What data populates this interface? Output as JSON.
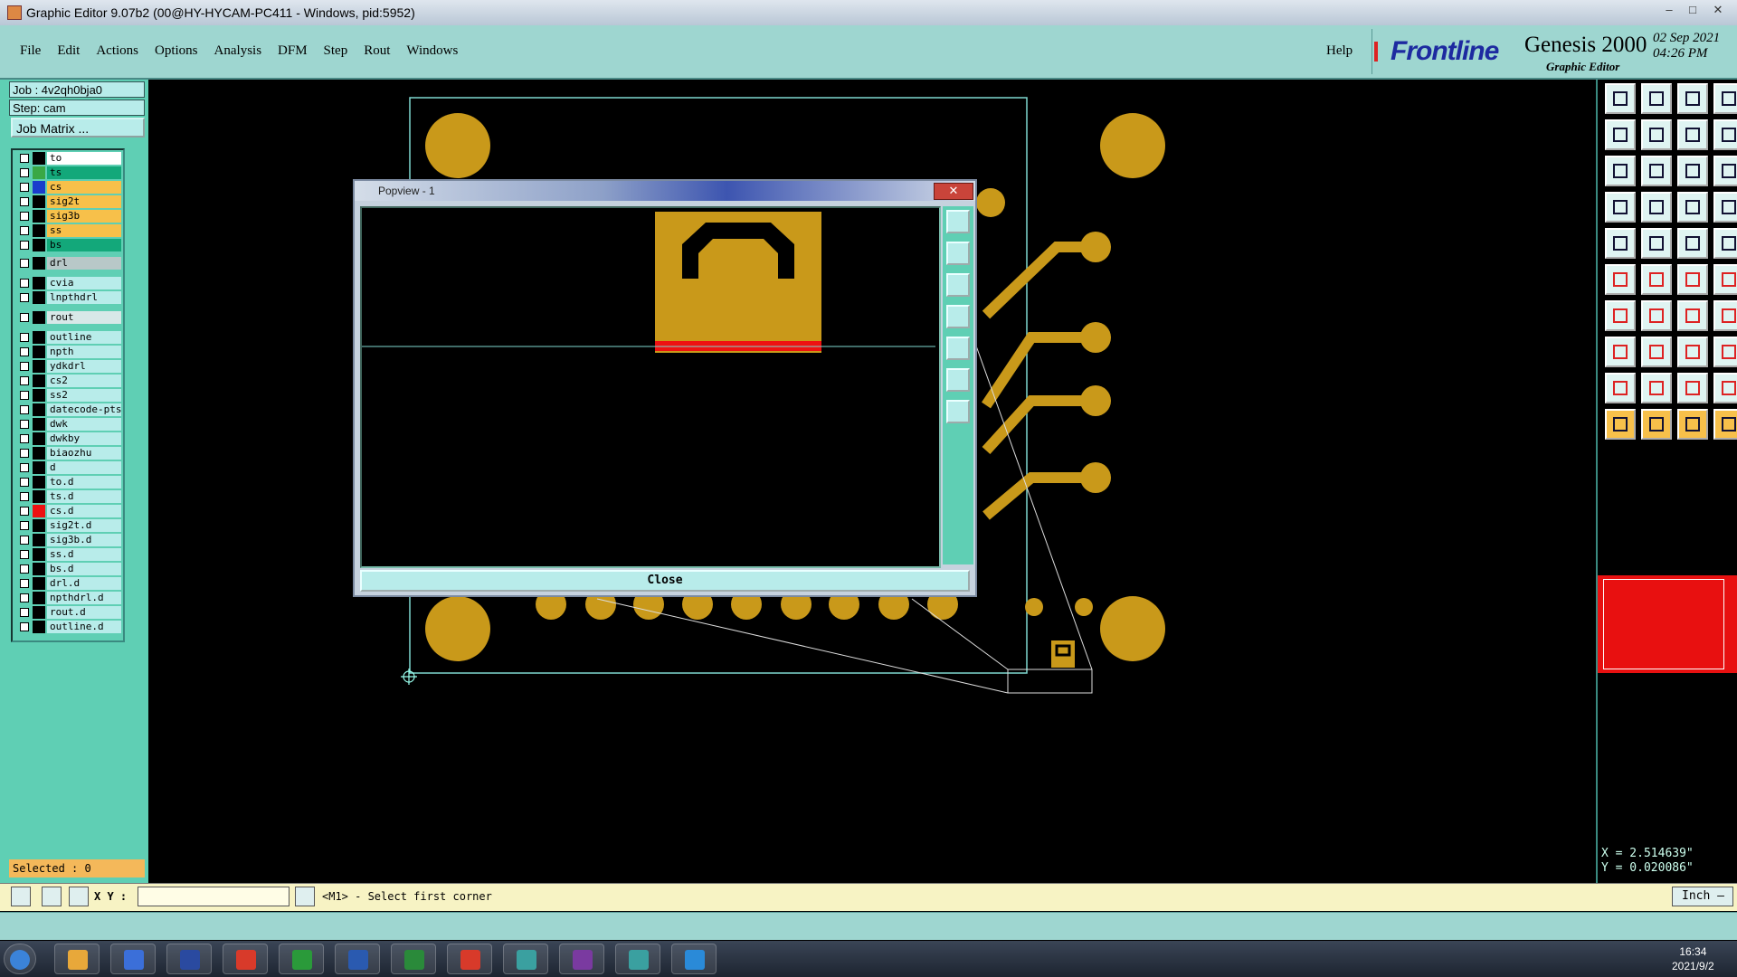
{
  "window": {
    "title": "Graphic Editor 9.07b2 (00@HY-HYCAM-PC411 - Windows, pid:5952)",
    "controls": [
      "–",
      "□",
      "✕"
    ]
  },
  "menu": {
    "items": [
      "File",
      "Edit",
      "Actions",
      "Options",
      "Analysis",
      "DFM",
      "Step",
      "Rout",
      "Windows"
    ],
    "help": "Help"
  },
  "brand": {
    "logo": "Frontline",
    "product": "Genesis 2000",
    "subtitle": "Graphic Editor",
    "date": "02 Sep 2021",
    "time": "04:26 PM"
  },
  "left": {
    "job": "Job : 4v2qh0bja0",
    "step": "Step: cam",
    "job_matrix": "Job Matrix ...",
    "selected": "Selected : 0"
  },
  "layers": [
    {
      "name": "to",
      "bg": "#ffffff",
      "mark": "#000000"
    },
    {
      "name": "ts",
      "bg": "#13a87a",
      "mark": "#3aa845"
    },
    {
      "name": "cs",
      "bg": "#f7c04a",
      "mark": "#1a3ccc"
    },
    {
      "name": "sig2t",
      "bg": "#f7c04a",
      "mark": "#000000"
    },
    {
      "name": "sig3b",
      "bg": "#f7c04a",
      "mark": "#000000"
    },
    {
      "name": "ss",
      "bg": "#f7c04a",
      "mark": "#000000"
    },
    {
      "name": "bs",
      "bg": "#13a87a",
      "mark": "#000000"
    },
    {
      "name": "drl",
      "bg": "#b8c8c8",
      "mark": "#000000"
    },
    {
      "name": "cvia",
      "bg": "#b8ecea",
      "mark": "#000000"
    },
    {
      "name": "lnpthdrl",
      "bg": "#b8ecea",
      "mark": "#000000"
    },
    {
      "name": "rout",
      "bg": "#d8e8e8",
      "mark": "#000000"
    },
    {
      "name": "outline",
      "bg": "#b8ecea",
      "mark": "#000000"
    },
    {
      "name": "npth",
      "bg": "#b8ecea",
      "mark": "#000000"
    },
    {
      "name": "ydkdrl",
      "bg": "#b8ecea",
      "mark": "#000000"
    },
    {
      "name": "cs2",
      "bg": "#b8ecea",
      "mark": "#000000"
    },
    {
      "name": "ss2",
      "bg": "#b8ecea",
      "mark": "#000000"
    },
    {
      "name": "datecode-pts",
      "bg": "#b8ecea",
      "mark": "#000000"
    },
    {
      "name": "dwk",
      "bg": "#b8ecea",
      "mark": "#000000"
    },
    {
      "name": "dwkby",
      "bg": "#b8ecea",
      "mark": "#000000"
    },
    {
      "name": "biaozhu",
      "bg": "#b8ecea",
      "mark": "#000000"
    },
    {
      "name": "d",
      "bg": "#b8ecea",
      "mark": "#000000"
    },
    {
      "name": "to.d",
      "bg": "#b8ecea",
      "mark": "#000000"
    },
    {
      "name": "ts.d",
      "bg": "#b8ecea",
      "mark": "#000000"
    },
    {
      "name": "cs.d",
      "bg": "#b8ecea",
      "mark": "#ee1111"
    },
    {
      "name": "sig2t.d",
      "bg": "#b8ecea",
      "mark": "#000000"
    },
    {
      "name": "sig3b.d",
      "bg": "#b8ecea",
      "mark": "#000000"
    },
    {
      "name": "ss.d",
      "bg": "#b8ecea",
      "mark": "#000000"
    },
    {
      "name": "bs.d",
      "bg": "#b8ecea",
      "mark": "#000000"
    },
    {
      "name": "drl.d",
      "bg": "#b8ecea",
      "mark": "#000000"
    },
    {
      "name": "npthdrl.d",
      "bg": "#b8ecea",
      "mark": "#000000"
    },
    {
      "name": "rout.d",
      "bg": "#b8ecea",
      "mark": "#000000"
    },
    {
      "name": "outline.d",
      "bg": "#b8ecea",
      "mark": "#000000"
    }
  ],
  "popview": {
    "title": "Popview - 1",
    "close_x": "✕",
    "close_label": "Close"
  },
  "command": {
    "xy_label": "X Y :",
    "xy_value": "",
    "prompt": "<M1> - Select first corner",
    "unit": "Inch –"
  },
  "coords": {
    "x": "X = 2.514639\"",
    "y": "Y = 0.020086\""
  },
  "colors": {
    "copper": "#c9991a",
    "panel": "#5fcfb4",
    "highlight_red": "#ee1111"
  },
  "taskbar": {
    "apps": [
      "start-orb",
      "folder",
      "notepad",
      "floppy",
      "g-app",
      "p-app",
      "word",
      "excel",
      "pdf",
      "eye-app",
      "x-app",
      "eye-app-2",
      "bird-app"
    ],
    "time": "16:34",
    "date": "2021/9/2"
  }
}
